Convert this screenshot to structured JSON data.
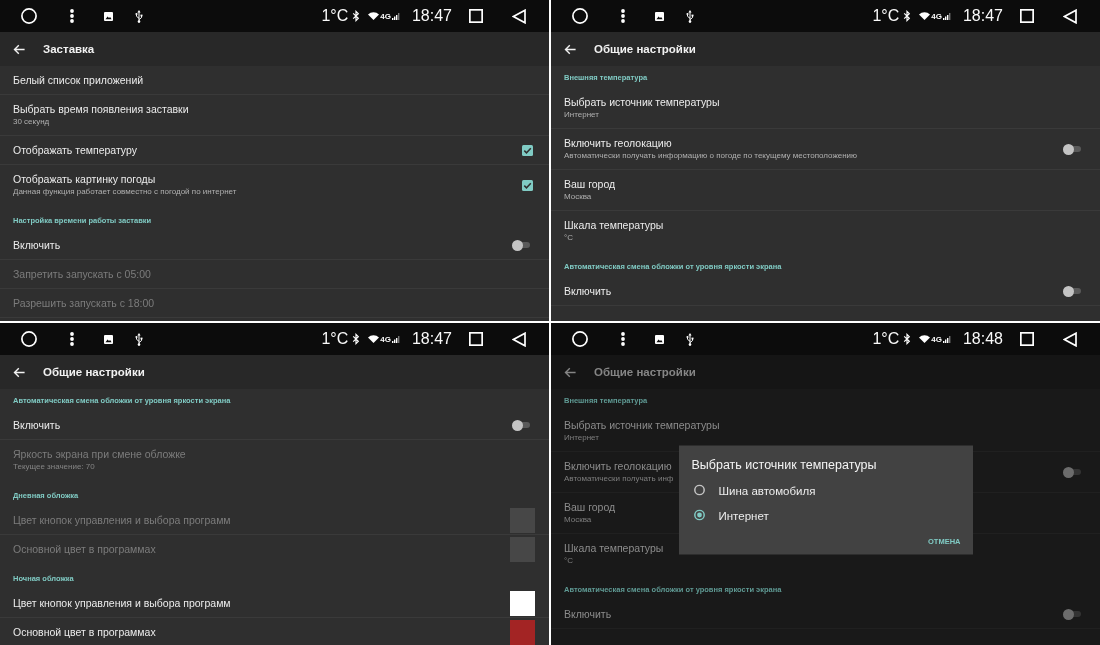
{
  "panels": [
    {
      "status_bar": {
        "temperature": "1°C",
        "network": "4G",
        "time": "18:47"
      },
      "app_bar": {
        "title": "Заставка"
      },
      "items": [
        {
          "kind": "text",
          "title": "Белый список приложений",
          "disabled": false
        },
        {
          "kind": "text",
          "title": "Выбрать время появления заставки",
          "summary": "30 секунд",
          "disabled": false
        },
        {
          "kind": "checkbox",
          "title": "Отображать температуру",
          "checked": true,
          "disabled": false
        },
        {
          "kind": "checkbox",
          "title": "Отображать картинку погоды",
          "summary": "Данная функция работает совместно с погодой по интернет",
          "checked": true,
          "disabled": false
        },
        {
          "kind": "category",
          "title": "Настройка времени работы заставки",
          "disabled": false
        },
        {
          "kind": "switch",
          "title": "Включить",
          "on": false,
          "disabled": false
        },
        {
          "kind": "text",
          "title": "Запретить запускать с 05:00",
          "disabled": true
        },
        {
          "kind": "text",
          "title": "Разрешить запускать с 18:00",
          "disabled": true
        }
      ]
    },
    {
      "status_bar": {
        "temperature": "1°C",
        "network": "4G",
        "time": "18:47"
      },
      "app_bar": {
        "title": "Общие настройки"
      },
      "items": [
        {
          "kind": "category",
          "title": "Внешняя температура",
          "disabled": false
        },
        {
          "kind": "text",
          "title": "Выбрать источник температуры",
          "summary": "Интернет",
          "disabled": false
        },
        {
          "kind": "switch",
          "title": "Включить геолокацию",
          "summary": "Автоматически получать информацию о погоде по текущему местоположению",
          "on": false,
          "disabled": false
        },
        {
          "kind": "text",
          "title": "Ваш город",
          "summary": "Москва",
          "disabled": false
        },
        {
          "kind": "text",
          "title": "Шкала температуры",
          "summary": "°C",
          "disabled": false
        },
        {
          "kind": "category",
          "title": "Автоматическая смена обложки от уровня яркости экрана",
          "disabled": false
        },
        {
          "kind": "switch",
          "title": "Включить",
          "on": false,
          "disabled": false
        }
      ]
    },
    {
      "status_bar": {
        "temperature": "1°C",
        "network": "4G",
        "time": "18:47"
      },
      "app_bar": {
        "title": "Общие настройки"
      },
      "items": [
        {
          "kind": "category",
          "title": "Автоматическая смена обложки от уровня яркости экрана",
          "disabled": false
        },
        {
          "kind": "switch",
          "title": "Включить",
          "on": false,
          "disabled": false
        },
        {
          "kind": "text",
          "title": "Яркость экрана при смене обложке",
          "summary": "Текущее значение: 70",
          "disabled": true
        },
        {
          "kind": "category",
          "title": "Дневная обложка",
          "disabled": false
        },
        {
          "kind": "color",
          "title": "Цвет кнопок управления и выбора программ",
          "color": "#474747",
          "disabled": true
        },
        {
          "kind": "color",
          "title": "Основной цвет в программах",
          "color": "#474747",
          "disabled": true
        },
        {
          "kind": "category",
          "title": "Ночная обложка",
          "disabled": false
        },
        {
          "kind": "color",
          "title": "Цвет кнопок управления и выбора программ",
          "color": "#ffffff",
          "disabled": false
        },
        {
          "kind": "color",
          "title": "Основной цвет в программах",
          "color": "#a32424",
          "disabled": false
        }
      ]
    },
    {
      "status_bar": {
        "temperature": "1°C",
        "network": "4G",
        "time": "18:48"
      },
      "app_bar": {
        "title": "Общие настройки"
      },
      "items": [
        {
          "kind": "category",
          "title": "Внешняя температура",
          "disabled": false
        },
        {
          "kind": "text",
          "title": "Выбрать источник температуры",
          "summary": "Интернет",
          "disabled": false
        },
        {
          "kind": "switch",
          "title": "Включить геолокацию",
          "summary": "Автоматически получать инф",
          "on": false,
          "disabled": false
        },
        {
          "kind": "text",
          "title": "Ваш город",
          "summary": "Москва",
          "disabled": false
        },
        {
          "kind": "text",
          "title": "Шкала температуры",
          "summary": "°C",
          "disabled": false
        },
        {
          "kind": "category",
          "title": "Автоматическая смена обложки от уровня яркости экрана",
          "disabled": false
        },
        {
          "kind": "switch",
          "title": "Включить",
          "on": false,
          "disabled": false
        }
      ],
      "dialog": {
        "title": "Выбрать источник температуры",
        "options": [
          {
            "label": "Шина автомобиля",
            "selected": false
          },
          {
            "label": "Интернет",
            "selected": true
          }
        ],
        "buttons": [
          "ОТМЕНА"
        ]
      }
    }
  ]
}
